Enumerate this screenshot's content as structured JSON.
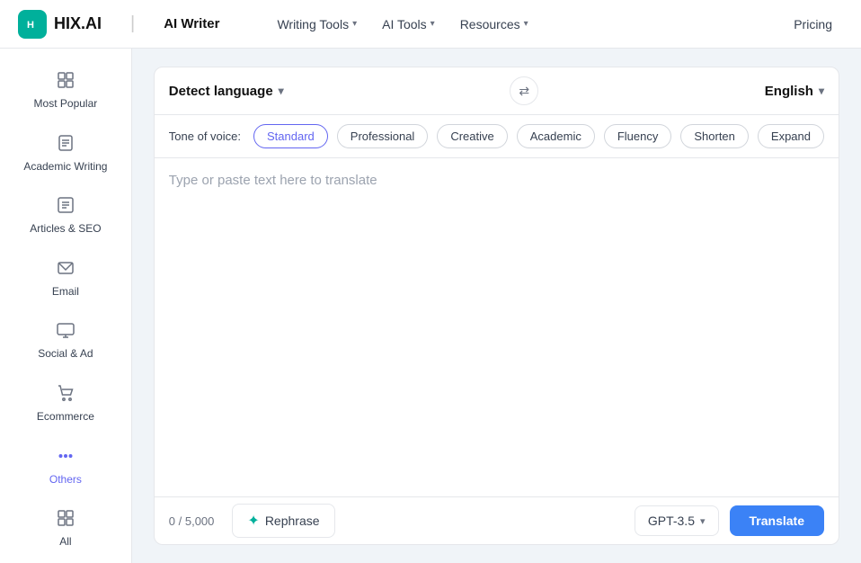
{
  "navbar": {
    "logo_text": "H",
    "brand": "HIX.AI",
    "divider": "|",
    "app_title": "AI Writer",
    "nav_items": [
      {
        "label": "Writing Tools",
        "has_dropdown": true
      },
      {
        "label": "AI Tools",
        "has_dropdown": true
      },
      {
        "label": "Resources",
        "has_dropdown": true
      }
    ],
    "pricing_label": "Pricing"
  },
  "sidebar": {
    "items": [
      {
        "id": "most-popular",
        "icon": "⊞",
        "label": "Most Popular"
      },
      {
        "id": "academic-writing",
        "icon": "📋",
        "label": "Academic Writing"
      },
      {
        "id": "articles-seo",
        "icon": "⬜",
        "label": "Articles & SEO"
      },
      {
        "id": "email",
        "icon": "✉",
        "label": "Email"
      },
      {
        "id": "social-ad",
        "icon": "🖥",
        "label": "Social & Ad"
      },
      {
        "id": "ecommerce",
        "icon": "🛒",
        "label": "Ecommerce"
      },
      {
        "id": "others",
        "icon": "···",
        "label": "Others",
        "active": true
      },
      {
        "id": "all",
        "icon": "⊞",
        "label": "All"
      }
    ]
  },
  "translator": {
    "source_lang": "Detect language",
    "target_lang": "English",
    "swap_icon": "⇄",
    "tone_label": "Tone of voice:",
    "tones": [
      {
        "label": "Standard",
        "active": true
      },
      {
        "label": "Professional"
      },
      {
        "label": "Creative"
      },
      {
        "label": "Academic"
      },
      {
        "label": "Fluency"
      },
      {
        "label": "Shorten"
      },
      {
        "label": "Expand"
      }
    ],
    "placeholder": "Type or paste text here to translate",
    "char_count": "0 / 5,000",
    "rephrase_label": "Rephrase",
    "gpt_version": "GPT-3.5",
    "translate_label": "Translate"
  }
}
